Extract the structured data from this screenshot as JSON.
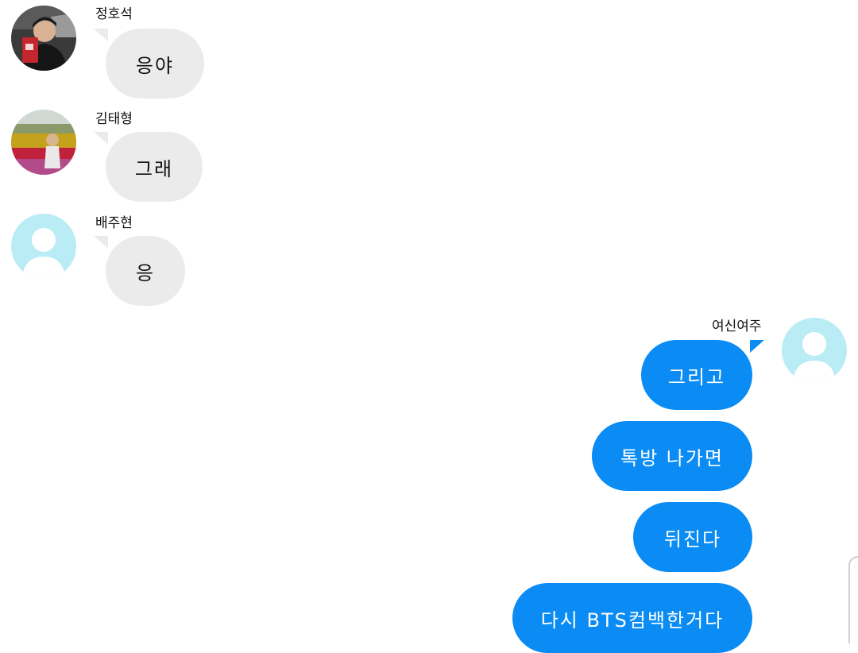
{
  "colors": {
    "incoming_bubble": "#ebebeb",
    "outgoing_bubble": "#0a8cf4",
    "default_avatar": "#b9ecf5"
  },
  "messages": [
    {
      "sender": "정호석",
      "text": "응야",
      "direction": "incoming",
      "avatar": "photo-avatar-person-red-bag"
    },
    {
      "sender": "김태형",
      "text": "그래",
      "direction": "incoming",
      "avatar": "photo-avatar-flower-field"
    },
    {
      "sender": "배주현",
      "text": "응",
      "direction": "incoming",
      "avatar": "default-user-icon"
    },
    {
      "sender": "여신여주",
      "direction": "outgoing",
      "avatar": "default-user-icon",
      "texts": [
        "그리고",
        "톡방 나가면",
        "뒤진다",
        "다시 BTS컴백한거다"
      ]
    }
  ]
}
